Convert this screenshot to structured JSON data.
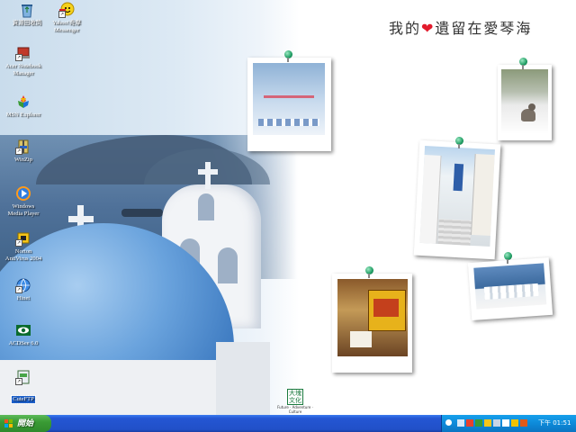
{
  "desktop": {
    "title_part1": "我的",
    "title_heart": "❤",
    "title_part2": "遺留在愛琴海",
    "culture_logo_text": "大塊文化",
    "culture_caption": "Future · Adventure · Culture",
    "icons": [
      {
        "label": "資源回收筒",
        "icon": "recycle-bin-icon"
      },
      {
        "label": "Yahoo!奇摩\nMessenger",
        "icon": "yahoo-messenger-icon"
      },
      {
        "label": "Acer Notebook\nManager",
        "icon": "acer-notebook-manager-icon"
      },
      {
        "label": "MSN Explorer",
        "icon": "msn-explorer-icon"
      },
      {
        "label": "WinZip",
        "icon": "winzip-icon"
      },
      {
        "label": "Windows\nMedia Player",
        "icon": "windows-media-player-icon"
      },
      {
        "label": "Norton\nAntiVirus 2004",
        "icon": "norton-antivirus-icon"
      },
      {
        "label": "Hinet",
        "icon": "hinet-icon"
      },
      {
        "label": "ACDSee 6.0",
        "icon": "acdsee-icon"
      },
      {
        "label": "CuteFTP",
        "icon": "cuteftp-icon"
      }
    ]
  },
  "taskbar": {
    "start_label": "開始",
    "clock": "下午 01:51",
    "colors": {
      "start": "#3a9b35",
      "bar": "#2456d3",
      "tray": "#0d8ad9"
    }
  }
}
